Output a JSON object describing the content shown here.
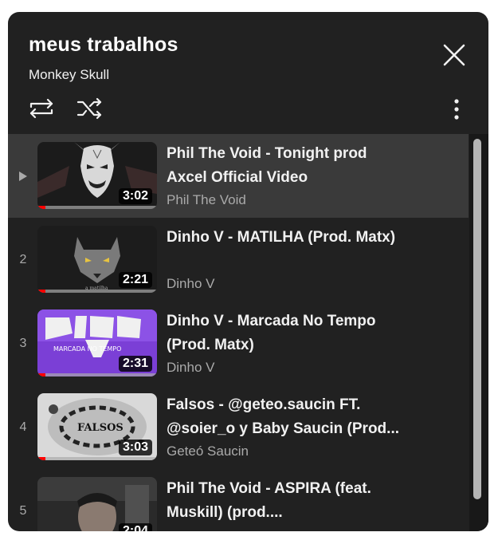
{
  "playlist": {
    "title": "meus trabalhos",
    "owner": "Monkey Skull"
  },
  "icons": {
    "close": "close-icon",
    "loop": "loop-icon",
    "shuffle": "shuffle-icon",
    "more": "more-vertical-icon",
    "now_playing": "play-arrow-icon"
  },
  "colors": {
    "panel_bg": "#212121",
    "active_row_bg": "#3a3a3a",
    "progress": "#ff0000",
    "secondary_text": "#aaaaaa"
  },
  "items": [
    {
      "index": "",
      "playing": true,
      "title": "Phil The Void - Tonight prod Axcel Official Video",
      "channel": "Phil The Void",
      "duration": "3:02"
    },
    {
      "index": "2",
      "playing": false,
      "title": "Dinho V - MATILHA (Prod. Matx)",
      "channel": "Dinho V",
      "duration": "2:21"
    },
    {
      "index": "3",
      "playing": false,
      "title": "Dinho V - Marcada No Tempo (Prod. Matx)",
      "channel": "Dinho V",
      "duration": "2:31"
    },
    {
      "index": "4",
      "playing": false,
      "title": "Falsos - @geteo.saucin FT. @soier_o y Baby Saucin (Prod...",
      "channel": "Geteó Saucin",
      "duration": "3:03"
    },
    {
      "index": "5",
      "playing": false,
      "title": "Phil The Void - ASPIRA (feat. Muskill) (prod....",
      "channel": "",
      "duration": "2:04"
    }
  ]
}
